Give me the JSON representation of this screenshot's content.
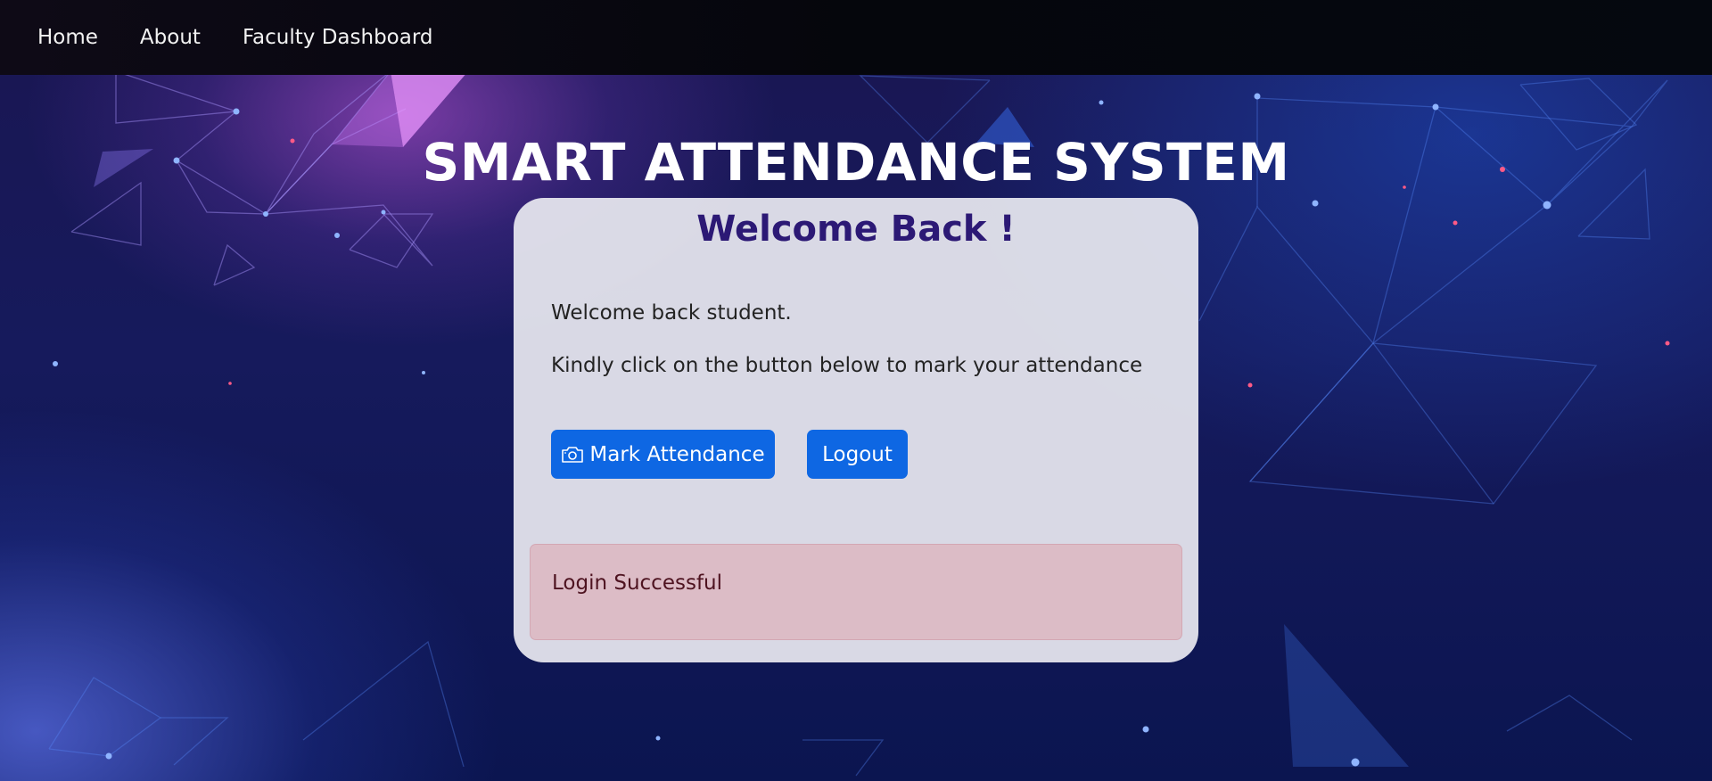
{
  "nav": {
    "items": [
      {
        "label": "Home"
      },
      {
        "label": "About"
      },
      {
        "label": "Faculty Dashboard"
      }
    ]
  },
  "page": {
    "title": "SMART ATTENDANCE SYSTEM"
  },
  "card": {
    "heading": "Welcome Back !",
    "greeting": "Welcome back student.",
    "instruction": "Kindly click on the button below to mark your attendance",
    "buttons": {
      "mark_attendance": "Mark Attendance",
      "logout": "Logout"
    },
    "alert": {
      "message": "Login Successful"
    }
  },
  "icons": {
    "mark_attendance_icon": "camera-icon"
  },
  "colors": {
    "primary_button": "#0e67e3",
    "heading": "#2c1975",
    "alert_background": "#dcbcc6",
    "alert_text": "#4e1320"
  }
}
